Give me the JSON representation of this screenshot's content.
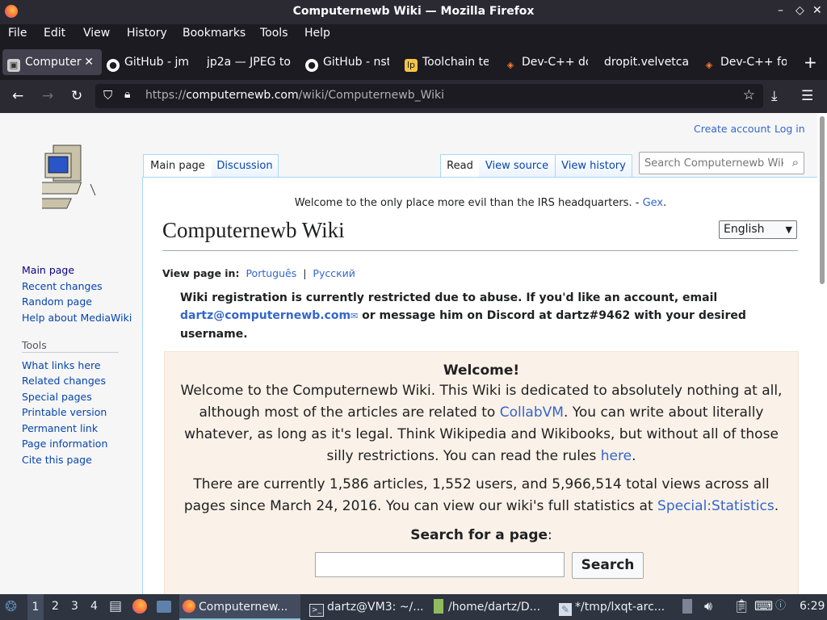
{
  "window": {
    "title": "Computernewb Wiki — Mozilla Firefox",
    "controls": [
      "–",
      "◇",
      "✕"
    ]
  },
  "menu": [
    "File",
    "Edit",
    "View",
    "History",
    "Bookmarks",
    "Tools",
    "Help"
  ],
  "tabs": [
    {
      "label": "Computer",
      "icon": "computernewb-favicon",
      "active": true
    },
    {
      "label": "GitHub - jm",
      "icon": "github-icon"
    },
    {
      "label": "jp2a — JPEG to",
      "icon": ""
    },
    {
      "label": "GitHub - nst",
      "icon": "github-icon"
    },
    {
      "label": "Toolchain te",
      "icon": "lp-icon"
    },
    {
      "label": "Dev-C++ do",
      "icon": "devcpp-icon"
    },
    {
      "label": "dropit.velvetca",
      "icon": ""
    },
    {
      "label": "Dev-C++ fo",
      "icon": "devcpp-icon"
    }
  ],
  "new_tab": "+",
  "address": {
    "prefix": "https://",
    "host": "computernewb.com",
    "path": "/wiki/Computernewb_Wiki"
  },
  "wiki": {
    "personal": {
      "create": "Create account",
      "login": "Log in"
    },
    "tabs_left": [
      "Main page",
      "Discussion"
    ],
    "tabs_right": [
      "Read",
      "View source",
      "View history"
    ],
    "search_placeholder": "Search Computernewb Wiki",
    "sidebar_nav": [
      "Main page",
      "Recent changes",
      "Random page",
      "Help about MediaWiki"
    ],
    "tools_heading": "Tools",
    "sidebar_tools": [
      "What links here",
      "Related changes",
      "Special pages",
      "Printable version",
      "Permanent link",
      "Page information",
      "Cite this page"
    ],
    "sitenotice": "Welcome to the only place more evil than the IRS headquarters. -",
    "sitenotice_link": "Gex",
    "sitenotice_end": ".",
    "heading": "Computernewb Wiki",
    "language": "English",
    "view_in_label": "View page in:",
    "view_in_langs": [
      "Português",
      "Русский"
    ],
    "notice_1": "Wiki registration is currently restricted due to abuse. If you'd like an account, email",
    "notice_email": "dartz@computernewb.com",
    "notice_2": "or message him on Discord at dartz#9462 with your desired",
    "notice_3": "username.",
    "welcome_title": "Welcome!",
    "p1_l1": "Welcome to the Computernewb Wiki. This Wiki is dedicated to absolutely nothing at all,",
    "p1_l2a": "although most of the articles are related to",
    "p1_l2_link": "CollabVM",
    "p1_l2b": ". You can write about literally",
    "p1_l3": "whatever, as long as it's legal. Think Wikipedia and Wikibooks, but without all of those",
    "p1_l4a": "silly restrictions. You can read the rules",
    "p1_l4_link": "here",
    "p1_l4b": ".",
    "p2_l1": "There are currently 1,586 articles, 1,552 users, and 5,966,514 total views across all",
    "p2_l2a": "pages since March 24, 2016. You can view our wiki's full statistics at",
    "p2_l2_link": "Special:Statistics",
    "p2_l2b": ".",
    "search_for_page": "Search for a page",
    "search_colon": ":",
    "search_button": "Search"
  },
  "taskbar": {
    "desktops": [
      "1",
      "2",
      "3",
      "4"
    ],
    "apps": [
      {
        "label": "Computernew...",
        "icon": "firefox-icon"
      },
      {
        "label": "dartz@VM3: ~/...",
        "icon": "terminal-icon"
      },
      {
        "label": "/home/dartz/D...",
        "icon": "file-manager-icon"
      },
      {
        "label": "*/tmp/lxqt-arc...",
        "icon": "text-editor-icon"
      }
    ],
    "clock": "6:29"
  }
}
